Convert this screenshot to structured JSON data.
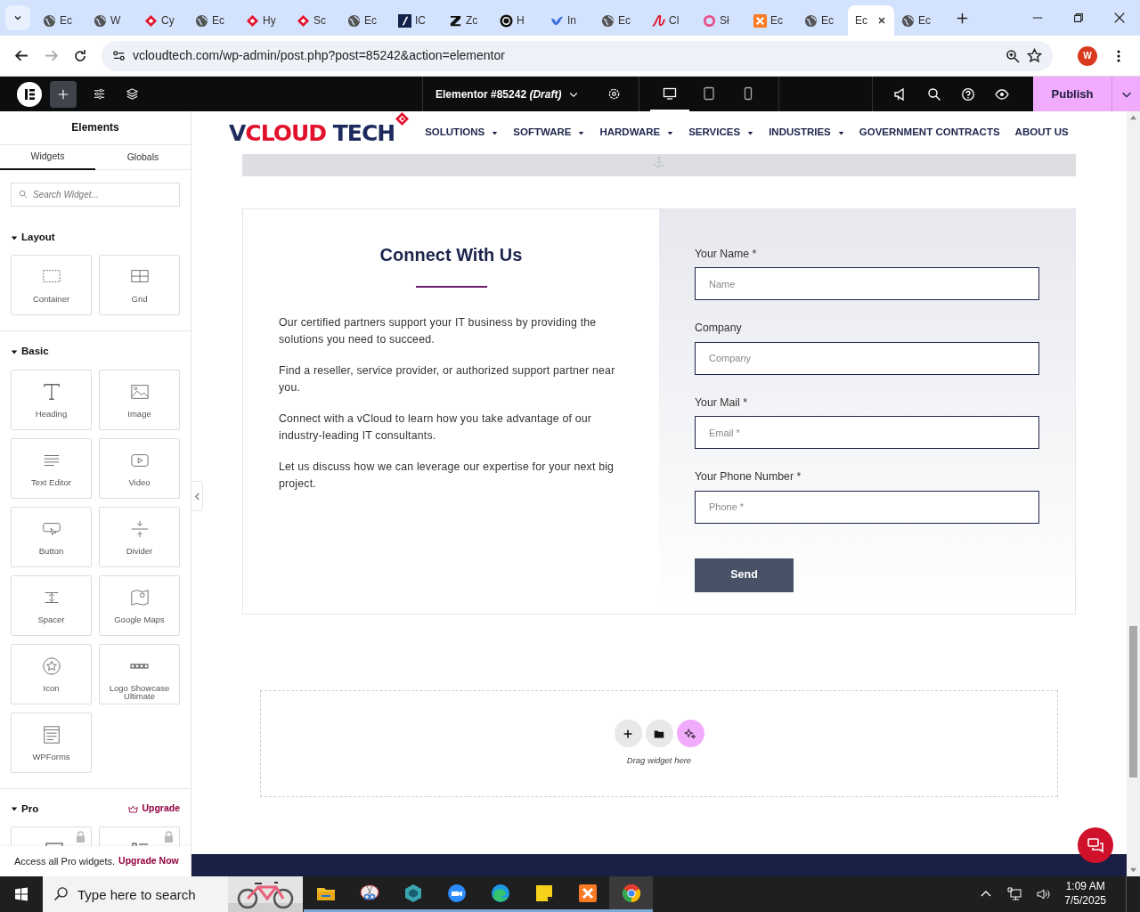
{
  "browser": {
    "tabs": [
      {
        "label": "Ec",
        "selected": false
      },
      {
        "label": "W",
        "selected": false
      },
      {
        "label": "Cy",
        "selected": false
      },
      {
        "label": "Ec",
        "selected": false
      },
      {
        "label": "Hy",
        "selected": false
      },
      {
        "label": "Sc",
        "selected": false
      },
      {
        "label": "Ec",
        "selected": false
      },
      {
        "label": "IC",
        "selected": false
      },
      {
        "label": "Zc",
        "selected": false
      },
      {
        "label": "H",
        "selected": false
      },
      {
        "label": "In",
        "selected": false
      },
      {
        "label": "Ec",
        "selected": false
      },
      {
        "label": "Cl",
        "selected": false
      },
      {
        "label": "Sł",
        "selected": false
      },
      {
        "label": "Ec",
        "selected": false
      },
      {
        "label": "Ec",
        "selected": false
      },
      {
        "label": "Ec",
        "selected": true
      },
      {
        "label": "Ec",
        "selected": false
      }
    ],
    "url": "vcloudtech.com/wp-admin/post.php?post=85242&action=elementor",
    "profile": "W"
  },
  "editor_bar": {
    "title": "Elementor #85242 *(Draft)*",
    "devices": [
      {
        "selected": true
      },
      {
        "selected": false
      },
      {
        "selected": false
      }
    ],
    "publish": "Publish"
  },
  "panel": {
    "title": "Elements",
    "tabs": [
      {
        "label": "Widgets",
        "selected": true
      },
      {
        "label": "Globals",
        "selected": false
      }
    ],
    "search": {
      "placeholder": "Search Widget..."
    },
    "sections": [
      {
        "title": "Layout",
        "expanded": true,
        "widgets": [
          {
            "label": "Container",
            "locked": false
          },
          {
            "label": "Grid",
            "locked": false
          }
        ]
      },
      {
        "title": "Basic",
        "expanded": true,
        "widgets": [
          {
            "label": "Heading",
            "locked": false
          },
          {
            "label": "Image",
            "locked": false
          },
          {
            "label": "Text Editor",
            "locked": false
          },
          {
            "label": "Video",
            "locked": false
          },
          {
            "label": "Button",
            "locked": false
          },
          {
            "label": "Divider",
            "locked": false
          },
          {
            "label": "Spacer",
            "locked": false
          },
          {
            "label": "Google Maps",
            "locked": false
          },
          {
            "label": "Icon",
            "locked": false
          },
          {
            "label": "Logo Showcase Ultimate",
            "locked": false
          },
          {
            "label": "WPForms",
            "locked": false
          }
        ]
      },
      {
        "title": "Pro",
        "expanded": true,
        "upgrade": "Upgrade",
        "widgets": [
          {
            "locked": true
          },
          {
            "locked": true
          }
        ]
      }
    ],
    "promo": {
      "text": "Access all Pro widgets.",
      "link": "Upgrade Now"
    }
  },
  "site": {
    "logo": [
      {
        "text": "V",
        "color": "#1f2b5c"
      },
      {
        "text": "CLOUD",
        "color": "#e2122c"
      },
      {
        "text": " TECH",
        "color": "#1f2b5c"
      }
    ],
    "nav": [
      {
        "label": "SOLUTIONS",
        "dropdown": true
      },
      {
        "label": "SOFTWARE",
        "dropdown": true
      },
      {
        "label": "HARDWARE",
        "dropdown": true
      },
      {
        "label": "SERVICES",
        "dropdown": true
      },
      {
        "label": "INDUSTRIES",
        "dropdown": true
      },
      {
        "label": "GOVERNMENT CONTRACTS",
        "dropdown": false
      },
      {
        "label": "ABOUT US",
        "dropdown": false
      }
    ]
  },
  "contact": {
    "heading": "Connect With Us",
    "paragraphs": [
      "Our certified partners support your IT business by providing the solutions you need to succeed.",
      "Find a reseller, service provider, or authorized support partner near you.",
      "Connect with a vCloud to learn how you take advantage of our industry-leading IT consultants.",
      "Let us discuss how we can leverage our expertise for your next big project."
    ],
    "fields": [
      {
        "label": "Your Name *",
        "placeholder": "Name"
      },
      {
        "label": "Company",
        "placeholder": "Company"
      },
      {
        "label": "Your Mail *",
        "placeholder": "Email *"
      },
      {
        "label": "Your Phone Number *",
        "placeholder": "Phone *"
      }
    ],
    "submit": "Send"
  },
  "drop_zone": {
    "hint": "Drag widget here"
  },
  "taskbar": {
    "search": {
      "placeholder": "Type here to search"
    },
    "apps": [
      {
        "selected": false
      },
      {
        "selected": false
      },
      {
        "selected": false
      },
      {
        "selected": false
      },
      {
        "selected": false
      },
      {
        "selected": false
      },
      {
        "selected": false
      },
      {
        "selected": true
      }
    ],
    "time": "1:09 AM",
    "date": "7/5/2025"
  }
}
